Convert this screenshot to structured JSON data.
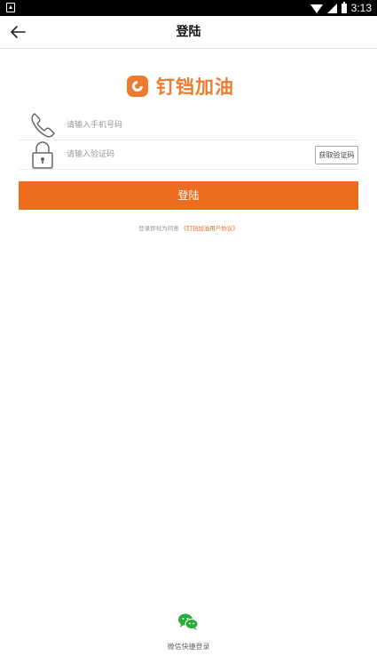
{
  "statusbar": {
    "time": "3:13"
  },
  "toolbar": {
    "title": "登陆"
  },
  "logo": {
    "text": "钉铛加油",
    "color": "#f07b2e"
  },
  "form": {
    "phone_placeholder": "请输入手机号码",
    "code_placeholder": "请输入验证码",
    "get_code_label": "获取验证码"
  },
  "login_button": {
    "label": "登陆",
    "color": "#ed6d1e"
  },
  "agreement": {
    "prefix": "登录即视为同意",
    "link": "《钉铛加油用户协议》"
  },
  "wechat": {
    "label": "微信快捷登录",
    "color": "#2aae3b"
  }
}
